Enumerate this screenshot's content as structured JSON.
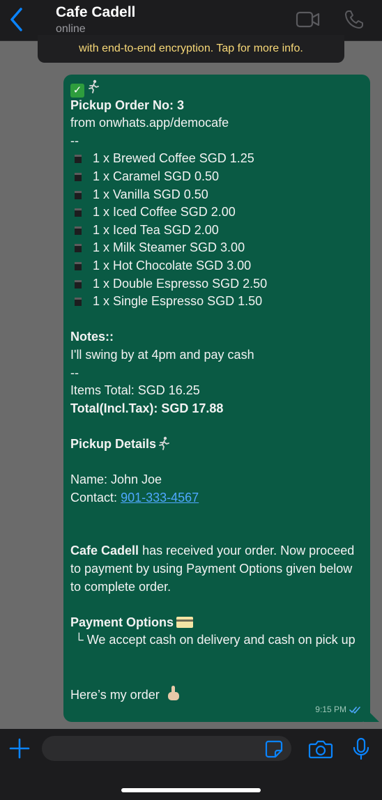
{
  "header": {
    "title": "Cafe Cadell",
    "status": "online"
  },
  "encryption_notice": "with end-to-end encryption. Tap for more info.",
  "message": {
    "order_title": "Pickup Order No: 3",
    "source": "from onwhats.app/democafe",
    "separator": "--",
    "items": [
      "1 x Brewed Coffee  SGD 1.25",
      "1 x Caramel  SGD 0.50",
      "1 x Vanilla  SGD 0.50",
      "1 x Iced Coffee  SGD 2.00",
      "1 x Iced Tea  SGD 2.00",
      "1 x Milk Steamer  SGD 3.00",
      "1 x Hot Chocolate  SGD 3.00",
      "1 x Double Espresso  SGD 2.50",
      "1 x Single Espresso  SGD 1.50"
    ],
    "notes_label": "Notes::",
    "notes_text": "I'll swing by at 4pm and pay cash",
    "items_total": "Items Total: SGD 16.25",
    "total": "Total(Incl.Tax): SGD 17.88",
    "pickup_details_label": "Pickup Details",
    "name_line": "Name: John Joe",
    "contact_label": "Contact:",
    "contact_phone": "901-333-4567",
    "received_bold": "Cafe Cadell",
    "received_text": "has received your order. Now proceed to payment by using Payment Options given below to complete order.",
    "payment_label": "Payment Options",
    "payment_text": "└ We accept cash on delivery and cash on pick up",
    "closing": "Here’s my order",
    "time": "9:15 PM"
  },
  "icons": {
    "back": "chevron-left-icon",
    "video": "video-call-icon",
    "phone": "phone-icon",
    "plus": "plus-icon",
    "sticker": "sticker-icon",
    "camera": "camera-icon",
    "mic": "microphone-icon"
  },
  "colors": {
    "bubble": "#0a5a44",
    "accent": "#0a84ff",
    "notice_text": "#f7d878",
    "read_ticks": "#4fa8ff"
  }
}
